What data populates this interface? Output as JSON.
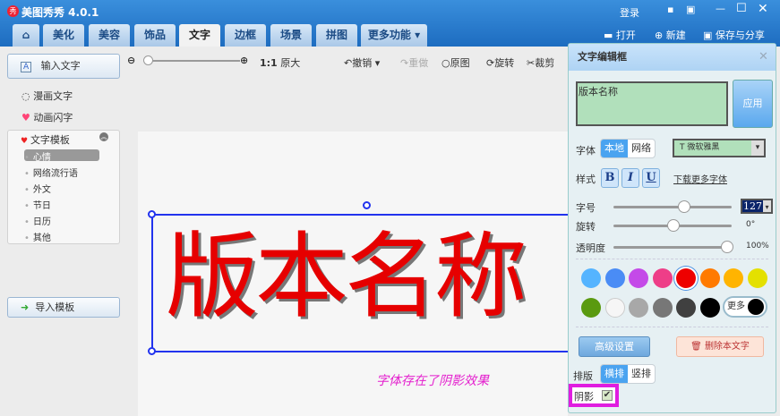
{
  "app": {
    "title": "美图秀秀 4.0.1",
    "logo": "秀",
    "login": "登录"
  },
  "tabs": [
    "美化",
    "美容",
    "饰品",
    "文字",
    "边框",
    "场景",
    "拼图",
    "更多功能"
  ],
  "active_tab": "文字",
  "top_actions": {
    "open": "打开",
    "new": "新建",
    "save": "保存与分享"
  },
  "sidebar": {
    "input_text": "输入文字",
    "comic_text": "漫画文字",
    "anim_text": "动画闪字",
    "template": "文字模板",
    "template_items": [
      "心情",
      "网络流行语",
      "外文",
      "节日",
      "日历",
      "其他"
    ],
    "import": "导入模板"
  },
  "toolbar": {
    "ratio": "1:1",
    "original_size": "原大",
    "undo": "撤销",
    "redo": "重做",
    "original": "原图",
    "rotate": "旋转",
    "crop": "裁剪",
    "zoom_level": 0
  },
  "canvas": {
    "text": "版本名称",
    "annotation": "字体存在了阴影效果"
  },
  "panel": {
    "title": "文字编辑框",
    "text_value": "版本名称",
    "apply": "应用",
    "font_label": "字体",
    "font_local": "本地",
    "font_web": "网络",
    "font_name": "微软雅黑",
    "style_label": "样式",
    "bold": "B",
    "italic": "I",
    "underline": "U",
    "download_fonts": "下载更多字体",
    "size_label": "字号",
    "size_value": "127",
    "size_fraction": 0.6,
    "rotate_label": "旋转",
    "rotate_value": "0°",
    "rotate_fraction": 0.5,
    "opacity_label": "透明度",
    "opacity_value": "100%",
    "opacity_fraction": 1.0,
    "colors": [
      "#55b4ff",
      "#4a8cf5",
      "#c44ae8",
      "#ee3e88",
      "#ee0000",
      "#ff7a00",
      "#ffb400",
      "#e4e000",
      "#5a9a10",
      "#f6f6f6",
      "#a8a8a8",
      "#777777",
      "#404040",
      "#000000"
    ],
    "selected_color": "#ee0000",
    "more_colors": "更多",
    "advanced": "高级设置",
    "delete_text": "删除本文字",
    "layout_label": "排版",
    "horizontal": "横排",
    "vertical": "竖排",
    "shadow_label": "阴影",
    "shadow_checked": true
  }
}
